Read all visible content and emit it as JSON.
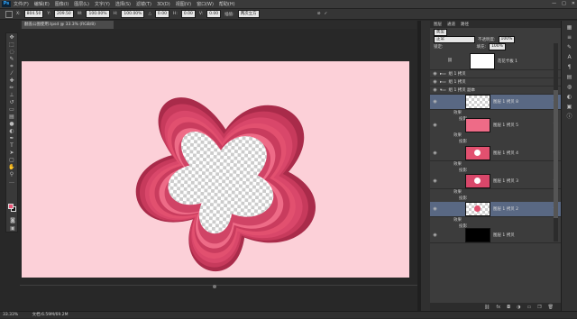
{
  "app": {
    "logo": "Ps",
    "menu": [
      "文件(F)",
      "编辑(E)",
      "图像(I)",
      "图层(L)",
      "文字(Y)",
      "选择(S)",
      "滤镜(T)",
      "3D(D)",
      "视图(V)",
      "窗口(W)",
      "帮助(H)"
    ],
    "window_controls": [
      "—",
      "□",
      "✕"
    ]
  },
  "options": {
    "x_label": "X:",
    "x": "804.50",
    "y_label": "Y:",
    "y": "209.50",
    "w_label": "W:",
    "w": "100.00%",
    "h_label": "H:",
    "h": "100.00%",
    "angle_label": "△",
    "angle": "0.00",
    "h_skew_label": "H:",
    "h_skew": "0.00",
    "v_skew_label": "V:",
    "v_skew": "0.00",
    "interpolation_label": "插值:",
    "interpolation": "两次立方"
  },
  "document": {
    "tab_title": "翻盖公图使用.tpsd @ 33.3% (RGB/8)"
  },
  "status": {
    "zoom": "33.33%",
    "doc_info": "文档:6.59M/69.2M"
  },
  "panel": {
    "tabs": [
      "图层",
      "通道",
      "路径"
    ],
    "filter_label": "类型",
    "blend_mode": "正常",
    "opacity_label": "不透明度:",
    "opacity": "100%",
    "lock_label": "锁定:",
    "fill_label": "填充:",
    "fill": "100%",
    "layers": [
      {
        "name": "花花卡板 1",
        "kind": "white",
        "selected": false,
        "fx": false
      },
      {
        "name": "组 1 拷贝",
        "kind": "group",
        "selected": false,
        "fx": false
      },
      {
        "name": "组 1 拷贝",
        "kind": "group",
        "selected": false,
        "fx": false
      },
      {
        "name": "组 1 拷贝 副本",
        "kind": "group-open",
        "selected": false,
        "fx": false
      },
      {
        "name": "图层 1 拷贝 8",
        "kind": "checker",
        "selected": true,
        "fx": true
      },
      {
        "name": "图层 1 拷贝 5",
        "kind": "pink",
        "selected": false,
        "fx": true
      },
      {
        "name": "图层 1 拷贝 4",
        "kind": "pink-flower",
        "selected": false,
        "fx": true
      },
      {
        "name": "图层 1 拷贝 3",
        "kind": "pink-flower",
        "selected": false,
        "fx": true
      },
      {
        "name": "图层 1 拷贝 2",
        "kind": "checker-flower",
        "selected": true,
        "fx": true
      },
      {
        "name": "图层 1 拷贝",
        "kind": "black",
        "selected": false,
        "fx": false
      }
    ],
    "effects_label": "效果",
    "shadow_label": "投影",
    "fx_mark": "fx",
    "footer_icons": [
      "link-icon",
      "fx-icon",
      "mask-icon",
      "adjust-icon",
      "folder-icon",
      "new-layer-icon",
      "trash-icon"
    ]
  },
  "colors": {
    "canvas": "#fcd0d8",
    "flower_outer": "#c73a5c",
    "flower_mid": "#e2506f",
    "flower_inner": "#ee6b87",
    "selected_layer": "#596883",
    "foreground": "#ea5477",
    "background": "#111111"
  }
}
